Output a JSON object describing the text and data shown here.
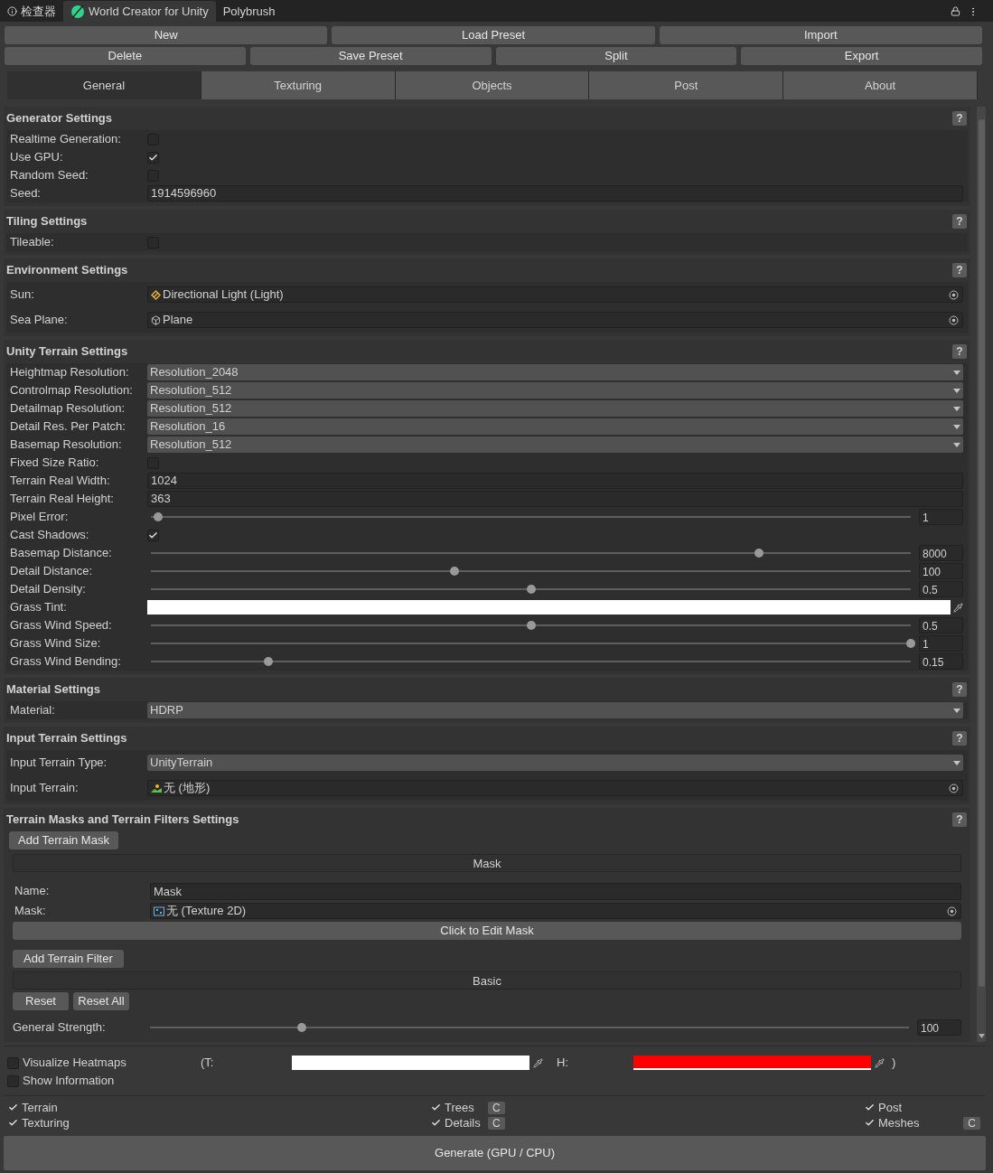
{
  "window_tabs": [
    {
      "label": "检查器",
      "selected": false
    },
    {
      "label": "World Creator for Unity",
      "selected": true
    },
    {
      "label": "Polybrush",
      "selected": false
    }
  ],
  "toolbar_rows": [
    [
      "New",
      "Load Preset",
      "Import"
    ],
    [
      "Delete",
      "Save Preset",
      "Split",
      "Export"
    ]
  ],
  "tabs": [
    {
      "label": "General",
      "selected": true
    },
    {
      "label": "Texturing",
      "selected": false
    },
    {
      "label": "Objects",
      "selected": false
    },
    {
      "label": "Post",
      "selected": false
    },
    {
      "label": "About",
      "selected": false
    }
  ],
  "sections": [
    {
      "title": "Generator Settings",
      "help": "?",
      "rows": [
        {
          "kind": "checkbox",
          "label": "Realtime Generation:",
          "checked": false
        },
        {
          "kind": "checkbox",
          "label": "Use GPU:",
          "checked": true
        },
        {
          "kind": "checkbox",
          "label": "Random Seed:",
          "checked": false
        },
        {
          "kind": "text",
          "label": "Seed:",
          "value": "1914596960"
        }
      ]
    },
    {
      "title": "Tiling Settings",
      "help": "?",
      "rows": [
        {
          "kind": "checkbox",
          "label": "Tileable:",
          "checked": false
        }
      ]
    },
    {
      "title": "Environment Settings",
      "help": "?",
      "rows": [
        {
          "kind": "object",
          "label": "Sun:",
          "value": "Directional Light (Light)"
        },
        {
          "kind": "object",
          "label": "Sea Plane:",
          "value": "Plane"
        }
      ]
    },
    {
      "title": "Unity Terrain Settings",
      "help": "?",
      "rows": [
        {
          "kind": "dropdown",
          "label": "Heightmap Resolution:",
          "value": "Resolution_2048"
        },
        {
          "kind": "dropdown",
          "label": "Controlmap Resolution:",
          "value": "Resolution_512"
        },
        {
          "kind": "dropdown",
          "label": "Detailmap Resolution:",
          "value": "Resolution_512"
        },
        {
          "kind": "dropdown",
          "label": "Detail Res. Per Patch:",
          "value": "Resolution_16"
        },
        {
          "kind": "dropdown",
          "label": "Basemap Resolution:",
          "value": "Resolution_512"
        },
        {
          "kind": "checkbox",
          "label": "Fixed Size Ratio:",
          "checked": false
        },
        {
          "kind": "text",
          "label": "Terrain Real Width:",
          "value": "1024"
        },
        {
          "kind": "text",
          "label": "Terrain Real Height:",
          "value": "363"
        },
        {
          "kind": "slider",
          "label": "Pixel Error:",
          "level": 0.01,
          "value": "1"
        },
        {
          "kind": "checkbox",
          "label": "Cast Shadows:",
          "checked": true
        },
        {
          "kind": "slider",
          "label": "Basemap Distance:",
          "level": 0.8,
          "value": "8000"
        },
        {
          "kind": "slider",
          "label": "Detail Distance:",
          "level": 0.4,
          "value": "100"
        },
        {
          "kind": "slider",
          "label": "Detail Density:",
          "level": 0.5,
          "value": "0.5"
        },
        {
          "kind": "color",
          "label": "Grass Tint:",
          "color": "#ffffff"
        },
        {
          "kind": "slider",
          "label": "Grass Wind Speed:",
          "level": 0.5,
          "value": "0.5"
        },
        {
          "kind": "slider",
          "label": "Grass Wind Size:",
          "level": 1,
          "value": "1"
        },
        {
          "kind": "slider",
          "label": "Grass Wind Bending:",
          "level": 0.155,
          "value": "0.15"
        }
      ]
    },
    {
      "title": "Material Settings",
      "help": "?",
      "rows": [
        {
          "kind": "dropdown",
          "label": "Material:",
          "value": "HDRP"
        }
      ]
    },
    {
      "title": "Input Terrain Settings",
      "help": "?",
      "rows": [
        {
          "kind": "dropdown",
          "label": "Input Terrain Type:",
          "value": "UnityTerrain"
        },
        {
          "kind": "object",
          "label": "Input Terrain:",
          "value": "无 (地形)"
        }
      ]
    }
  ],
  "mask_section": {
    "title": "Terrain Masks and Terrain Filters Settings",
    "help": "?",
    "add_mask": "Add Terrain Mask",
    "mask_header": "Mask",
    "name": {
      "label": "Name:",
      "value": "Mask"
    },
    "mask": {
      "label": "Mask:",
      "value": "无 (Texture 2D)"
    },
    "edit_button": "Click to Edit Mask",
    "add_filter": "Add Terrain Filter",
    "filter_header": "Basic",
    "buttons": [
      "Reset",
      "Reset All"
    ],
    "strength": {
      "label": "General Strength:",
      "level": 0.2,
      "value": "100"
    }
  },
  "footer": {
    "visualize": {
      "label": "Visualize Heatmaps",
      "checked": false
    },
    "info": {
      "label": "Show Information",
      "checked": false
    },
    "swatches": [
      {
        "label": "(T:",
        "color": "#ffffff"
      },
      {
        "label": "H:",
        "color": "#ff0000"
      }
    ],
    "close": ")",
    "toggles": [
      {
        "label": "Terrain",
        "checked": true
      },
      {
        "label": "Texturing",
        "checked": true
      },
      {
        "label": "Trees",
        "checked": true,
        "button": "C"
      },
      {
        "label": "Details",
        "checked": true,
        "button": "C"
      },
      {
        "label": "Post",
        "checked": true
      },
      {
        "label": "Meshes",
        "checked": true,
        "button": "C"
      }
    ],
    "generate": "Generate (GPU / CPU)"
  }
}
